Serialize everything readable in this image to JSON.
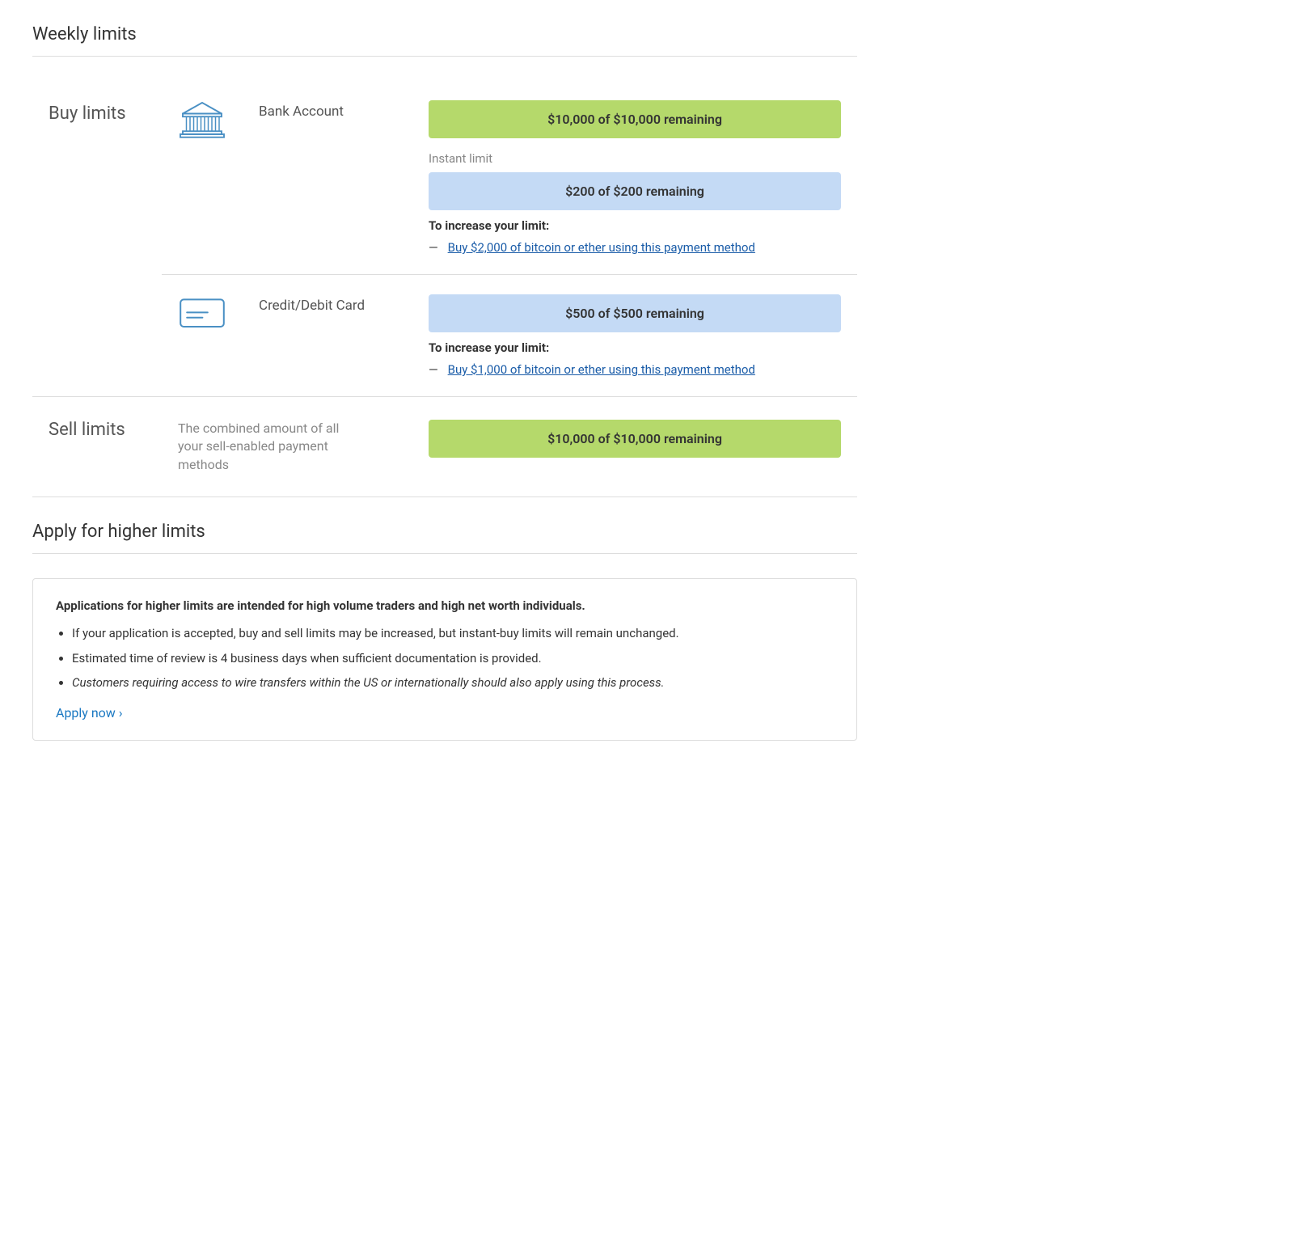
{
  "page": {
    "weekly_limits_title": "Weekly limits",
    "apply_section_title": "Apply for higher limits"
  },
  "buy_limits": {
    "section_label": "Buy limits",
    "bank_account": {
      "name": "Bank Account",
      "weekly_bar": "$10,000 of $10,000 remaining",
      "instant_label": "Instant limit",
      "instant_bar": "$200 of $200 remaining",
      "increase_label": "To increase your limit:",
      "increase_dash": "—",
      "increase_link": "Buy $2,000 of bitcoin or ether using this payment method"
    },
    "credit_card": {
      "name": "Credit/Debit Card",
      "weekly_bar": "$500 of $500 remaining",
      "increase_label": "To increase your limit:",
      "increase_dash": "—",
      "increase_link": "Buy $1,000 of bitcoin or ether using this payment method"
    }
  },
  "sell_limits": {
    "section_label": "Sell limits",
    "description": "The combined amount of all your sell-enabled payment methods",
    "bar": "$10,000 of $10,000 remaining"
  },
  "apply_higher": {
    "title": "Apply for higher limits",
    "box_title": "Applications for higher limits are intended for high volume traders and high net worth individuals.",
    "bullets": [
      "If your application is accepted, buy and sell limits may be increased, but instant-buy limits will remain unchanged.",
      "Estimated time of review is 4 business days when sufficient documentation is provided.",
      "Customers requiring access to wire transfers within the US or internationally should also apply using this process."
    ],
    "apply_now_label": "Apply now ›"
  }
}
